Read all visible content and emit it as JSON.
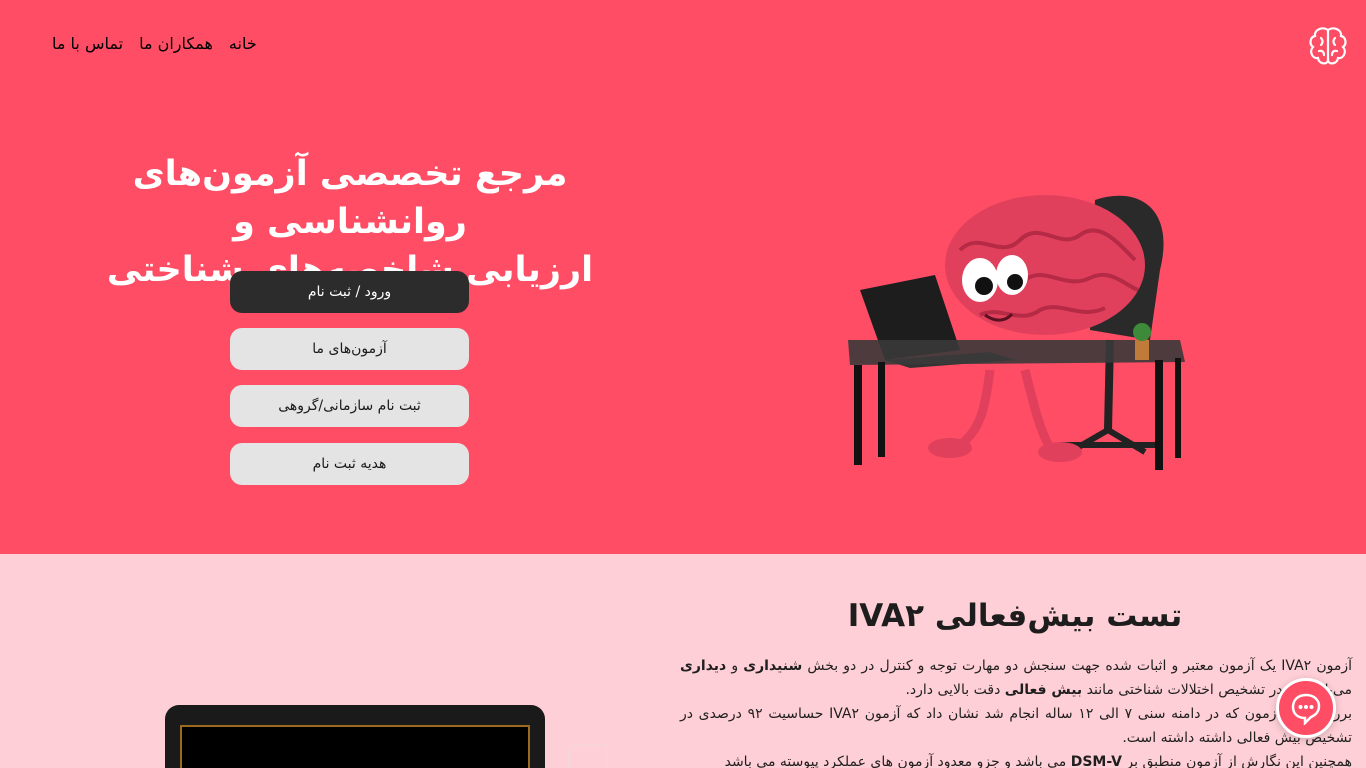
{
  "nav": {
    "items": [
      "خانه",
      "همکاران ما",
      "تماس با ما"
    ]
  },
  "hero": {
    "title_line1": "مرجع تخصصی آزمون‌های روانشناسی و",
    "title_line2": "ارزیابی شاخصه‌های شناختی",
    "buttons": [
      "ورود / ثبت نام",
      "آزمون‌های ما",
      "ثبت نام سازمانی/گروهی",
      "هدیه ثبت نام"
    ]
  },
  "section": {
    "title": "تست بیش‌فعالی IVA۲",
    "p1_a": "آزمون IVA۲ یک آزمون معتبر و اثبات شده جهت سنجش دو مهارت توجه و کنترل در دو بخش ",
    "p1_b": "شنیداری",
    "p1_c": " و ",
    "p1_d": "دیداری",
    "p1_e": " می‌باشد که در تشخیص اختلالات شناختی مانند ",
    "p1_f": "بیش فعالی",
    "p1_g": " دقت بالایی دارد.",
    "p2": "بررسی این آزمون که در دامنه سنی ۷ الی ۱۲ ساله انجام شد نشان داد که آزمون IVA۲ حساسیت ۹۲ درصدی در تشخیص بیش فعالی داشته داشته است.",
    "p3_a": "همچنین این نگارش از آزمون منطبق بر ",
    "p3_b": "DSM-V",
    "p3_c": " می باشد و جزو معدود آزمون های عملکرد پیوسته می باشد"
  },
  "colors": {
    "hero_bg": "#fe4d64",
    "page_bg": "#ffcfd7",
    "dark_button": "#2c2c2c",
    "light_button": "#e4e4e4"
  },
  "icons": {
    "logo": "brain-logo-icon",
    "chat": "chat-bubble-icon"
  }
}
